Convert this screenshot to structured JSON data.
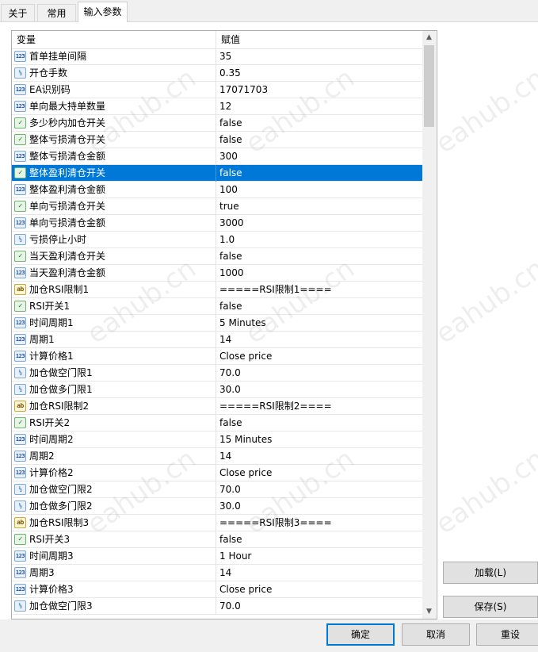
{
  "tabs": [
    {
      "label": "关于"
    },
    {
      "label": "常用"
    },
    {
      "label": "输入参数"
    }
  ],
  "table": {
    "col_variable": "变量",
    "col_value": "赋值",
    "rows": [
      {
        "icon": "int",
        "name": "首单挂单间隔",
        "value": "35"
      },
      {
        "icon": "double",
        "name": "开仓手数",
        "value": "0.35"
      },
      {
        "icon": "int",
        "name": "EA识别码",
        "value": "17071703"
      },
      {
        "icon": "int",
        "name": "单向最大持单数量",
        "value": "12"
      },
      {
        "icon": "bool",
        "name": "多少秒内加仓开关",
        "value": "false"
      },
      {
        "icon": "bool",
        "name": "整体亏损清仓开关",
        "value": "false"
      },
      {
        "icon": "int",
        "name": "整体亏损清仓金额",
        "value": "300"
      },
      {
        "icon": "bool",
        "name": "整体盈利清仓开关",
        "value": "false"
      },
      {
        "icon": "int",
        "name": "整体盈利清仓金额",
        "value": "100"
      },
      {
        "icon": "bool",
        "name": "单向亏损清仓开关",
        "value": "true"
      },
      {
        "icon": "int",
        "name": "单向亏损清仓金额",
        "value": "3000"
      },
      {
        "icon": "double",
        "name": "亏损停止小时",
        "value": "1.0"
      },
      {
        "icon": "bool",
        "name": "当天盈利清仓开关",
        "value": "false"
      },
      {
        "icon": "int",
        "name": "当天盈利清仓金额",
        "value": "1000"
      },
      {
        "icon": "string",
        "name": "加仓RSI限制1",
        "value": "=====RSI限制1===="
      },
      {
        "icon": "bool",
        "name": "RSI开关1",
        "value": "false"
      },
      {
        "icon": "int",
        "name": "时间周期1",
        "value": "5 Minutes"
      },
      {
        "icon": "int",
        "name": "周期1",
        "value": "14"
      },
      {
        "icon": "int",
        "name": "计算价格1",
        "value": "Close price"
      },
      {
        "icon": "double",
        "name": "加仓做空门限1",
        "value": "70.0"
      },
      {
        "icon": "double",
        "name": "加仓做多门限1",
        "value": "30.0"
      },
      {
        "icon": "string",
        "name": "加仓RSI限制2",
        "value": "=====RSI限制2===="
      },
      {
        "icon": "bool",
        "name": "RSI开关2",
        "value": "false"
      },
      {
        "icon": "int",
        "name": "时间周期2",
        "value": "15 Minutes"
      },
      {
        "icon": "int",
        "name": "周期2",
        "value": "14"
      },
      {
        "icon": "int",
        "name": "计算价格2",
        "value": "Close price"
      },
      {
        "icon": "double",
        "name": "加仓做空门限2",
        "value": "70.0"
      },
      {
        "icon": "double",
        "name": "加仓做多门限2",
        "value": "30.0"
      },
      {
        "icon": "string",
        "name": "加仓RSI限制3",
        "value": "=====RSI限制3===="
      },
      {
        "icon": "bool",
        "name": "RSI开关3",
        "value": "false"
      },
      {
        "icon": "int",
        "name": "时间周期3",
        "value": "1 Hour"
      },
      {
        "icon": "int",
        "name": "周期3",
        "value": "14"
      },
      {
        "icon": "int",
        "name": "计算价格3",
        "value": "Close price"
      },
      {
        "icon": "double",
        "name": "加仓做空门限3",
        "value": "70.0"
      }
    ],
    "selected_row": 7
  },
  "icon_glyphs": {
    "int": "123",
    "double": "½",
    "bool": "✓",
    "string": "ab"
  },
  "buttons": {
    "load": "加载(L)",
    "save": "保存(S)",
    "ok": "确定",
    "cancel": "取消",
    "reset": "重设"
  },
  "watermark": "eahub.cn",
  "colors": {
    "selection": "#0078d7",
    "default_button_border": "#0078d7"
  }
}
